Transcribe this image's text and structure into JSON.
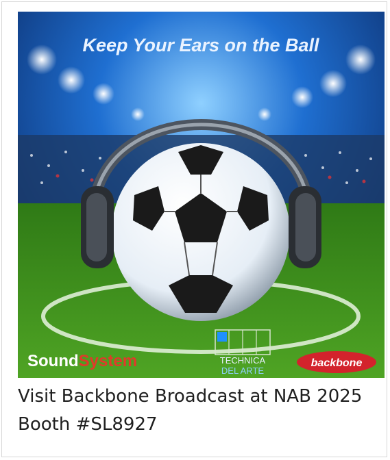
{
  "ad": {
    "headline": "Keep Your Ears on the Ball",
    "sponsors": {
      "soundsystem_a": "Sound",
      "soundsystem_b": "System",
      "technica_line1": "TECHNICA",
      "technica_line2": "DEL ARTE",
      "backbone": "backbone"
    },
    "colors": {
      "sky_top": "#0a1f5c",
      "sky_mid": "#1f6fd1",
      "grass": "#3d8c1f",
      "soundsystem_red": "#e03a2a",
      "backbone_red": "#d3232c",
      "technica_blue": "#1e90ff"
    }
  },
  "caption": {
    "text": "Visit Backbone Broadcast at NAB 2025 Booth #SL8927"
  }
}
